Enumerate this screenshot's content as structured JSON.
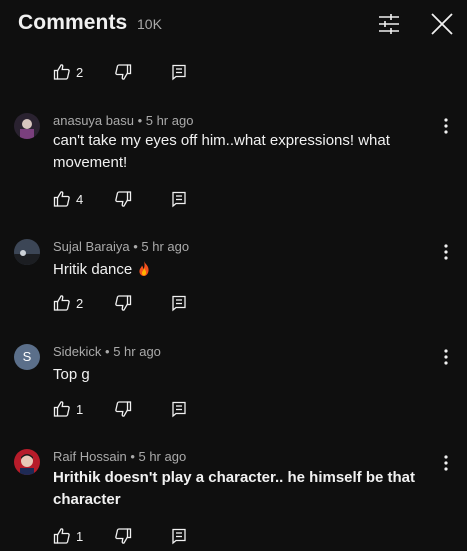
{
  "header": {
    "title": "Comments",
    "count": "10K"
  },
  "top_actions": {
    "likes": "2"
  },
  "comments": [
    {
      "author": "anasuya basu",
      "time": "5 hr ago",
      "text": "can't take my eyes off him..what expressions! what movement!",
      "likes": "4"
    },
    {
      "author": "Sujal Baraiya",
      "time": "5 hr ago",
      "text": "Hritik dance",
      "emoji": "fire-emoji",
      "likes": "2"
    },
    {
      "author": "Sidekick",
      "avatar_letter": "S",
      "time": "5 hr ago",
      "text": "Top g",
      "likes": "1"
    },
    {
      "author": "Raif Hossain",
      "time": "5 hr ago",
      "text": "Hrithik doesn't play a character.. he himself be that character",
      "likes": "1"
    }
  ],
  "separator": " • ",
  "colors": {
    "background": "#0f0f0f",
    "primary_text": "#f1f1f1",
    "secondary_text": "#aaaaaa",
    "letter_avatar": "#5b6f8a"
  },
  "icons": [
    "filter-icon",
    "close-icon",
    "thumbs-up-icon",
    "thumbs-down-icon",
    "reply-icon",
    "more-vert-icon"
  ]
}
